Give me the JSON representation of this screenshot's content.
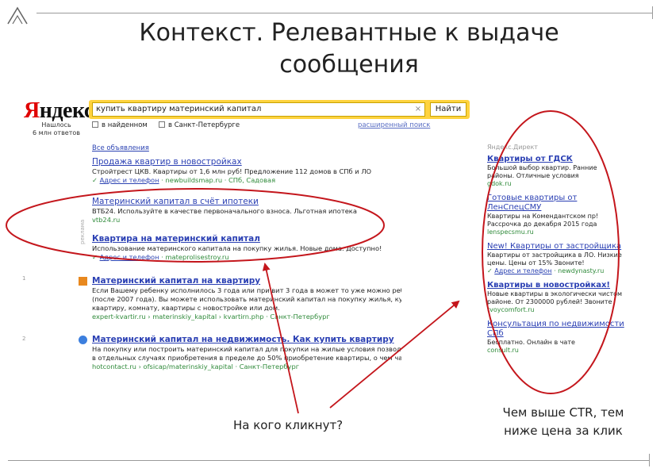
{
  "slide": {
    "title_line1": "Контекст. Релевантные к выдаче",
    "title_line2": "сообщения",
    "caption_left": "На кого кликнут?",
    "caption_right_line1": "Чем выше CTR, тем",
    "caption_right_line2": "ниже цена за клик"
  },
  "colors": {
    "annotation": "#c4161c",
    "link": "#2a3fb3",
    "url": "#2f8a3a",
    "search_bar": "#ffd33f",
    "logo_accent": "#e00000"
  },
  "yandex": {
    "logo_first": "Я",
    "logo_rest": "ндекс",
    "stats_line1": "Нашлось",
    "stats_line2": "6 млн ответов"
  },
  "search": {
    "query": "купить квартиру материнский капитал",
    "clear_icon": "×",
    "button": "Найти",
    "opt_found": "в найденном",
    "opt_region": "в Санкт-Петербурге",
    "advanced": "расширенный поиск"
  },
  "results": {
    "all_ads": "Все объявления",
    "items": [
      {
        "title": "Продажа квартир в новостройках",
        "desc": "Стройтрест ЦКВ. Квартиры от 1,6 млн руб! Предложение 112 домов в СПб и ЛО",
        "url_aux": "Адрес и телефон",
        "url": "· newbuildsmap.ru · СПб, Садовая"
      },
      {
        "title": "Материнский капитал в счёт ипотеки",
        "desc": "ВТБ24. Используйте в качестве первоначального взноса. Льготная ипотека",
        "url": "vtb24.ru"
      },
      {
        "title": "Квартира на материнский капитал",
        "desc": "Использование материнского капитала на покупку жилья. Новые дома. Доступно!",
        "url_aux": "Адрес и телефон",
        "url": "· mateprolisestroy.ru"
      },
      {
        "num": "1",
        "title": "Материнский капитал на квартиру",
        "desc1": "Если Вашему ребенку исполнилось 3 года или при вит 3 года в может то уже можно ребенок",
        "desc2": "(после 2007 года). Вы можете использовать материнский капитал на покупку жилья, купить",
        "desc3": "квартиру, комнату, квартиры с новостройке или дом.",
        "url": "expert-kvartir.ru › materinskiy_kapital › kvartirn.php · Санкт-Петербург"
      },
      {
        "num": "2",
        "title": "Материнский капитал на недвижимость. Как купить квартиру",
        "desc1": "На покупку или построить материнский капитал для покупки на жилые условия позволяет",
        "desc2": "в отдельных случаях приобретения в пределе до 50% приобретение квартиры, о чем частично.",
        "url": "hotcontact.ru › ofsicap/materinskiy_kapital · Санкт-Петербург"
      }
    ]
  },
  "right_ads": {
    "header": "Яндекс.Директ",
    "items": [
      {
        "title": "Квартиры от ГДСК",
        "desc": "Большой выбор квартир. Ранние районы. Отличные условия",
        "url": "gdok.ru"
      },
      {
        "title": "Готовые квартиры от ЛенСпецСМУ",
        "desc": "Квартиры на Комендантском пр! Рассрочка до декабря 2015 года",
        "url": "lenspecsmu.ru"
      },
      {
        "title": "New! Квартиры от застройщика",
        "desc": "Квартиры от застройщика в ЛО. Низкие цены. Цены от 15% Звоните!",
        "url_aux": "Адрес и телефон",
        "url": "· newdynasty.ru"
      },
      {
        "title": "Квартиры в новостройках!",
        "desc": "Новые квартиры в экологически чистом районе. От 2300000 рублей! Звоните",
        "url": "tvoycomfort.ru"
      },
      {
        "title": "Консультация по недвижимости СПб",
        "desc": "Бесплатно. Онлайн в чате",
        "url": "consult.ru"
      }
    ]
  }
}
